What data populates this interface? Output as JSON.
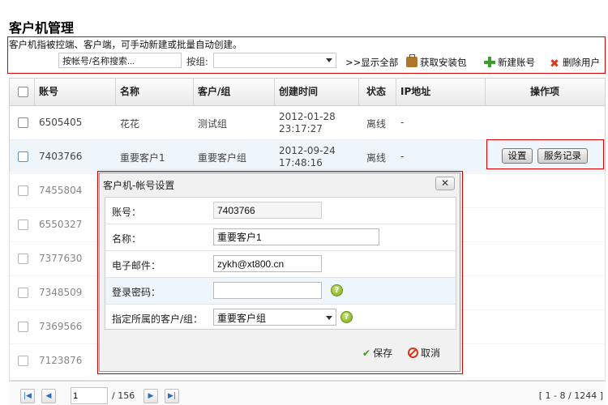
{
  "page": {
    "title": "客户机管理"
  },
  "toolbar": {
    "description": "客户机指被控端、客户端，可手动新建或批量自动创建。",
    "search_placeholder": "按帐号/名称搜索...",
    "group_label": "按组:",
    "group_value": "",
    "show_all": ">>显示全部",
    "get_installer": "获取安装包",
    "new_account": "新建账号",
    "delete_user": "删除用户"
  },
  "table": {
    "columns": [
      "账号",
      "名称",
      "客户/组",
      "创建时间",
      "状态",
      "IP地址",
      "操作项"
    ],
    "rows": [
      {
        "account": "6505405",
        "name": "花花",
        "group": "测试组",
        "date": "2012-01-28",
        "time": "23:17:27",
        "status": "离线",
        "ip": "-"
      },
      {
        "account": "7403766",
        "name": "重要客户1",
        "group": "重要客户组",
        "date": "2012-09-24",
        "time": "17:48:16",
        "status": "离线",
        "ip": "-"
      },
      {
        "account": "7455804"
      },
      {
        "account": "6550327"
      },
      {
        "account": "7377630"
      },
      {
        "account": "7348509"
      },
      {
        "account": "7369566"
      },
      {
        "account": "7123876"
      }
    ],
    "actions": {
      "settings": "设置",
      "service_log": "服务记录"
    }
  },
  "pager": {
    "page": "1",
    "total": "/ 156",
    "range": "[ 1 - 8 / 1244 ]"
  },
  "modal": {
    "title": "客户机-帐号设置",
    "close": "✕",
    "fields": {
      "account_label": "账号：",
      "account_value": "7403766",
      "name_label": "名称：",
      "name_value": "重要客户1",
      "email_label": "电子邮件：",
      "email_value": "zykh@xt800.cn",
      "password_label": "登录密码：",
      "password_value": "",
      "group_label": "指定所属的客户/组：",
      "group_value": "重要客户组"
    },
    "save": "保存",
    "cancel": "取消"
  },
  "colors": {
    "highlight_border": "#e00000",
    "row_selected": "#eef6fc"
  },
  "icons": [
    "briefcase-icon",
    "plus-icon",
    "delete-icon",
    "help-icon",
    "check-icon",
    "cancel-icon",
    "first-page-icon",
    "prev-page-icon",
    "next-page-icon",
    "last-page-icon",
    "close-icon"
  ]
}
